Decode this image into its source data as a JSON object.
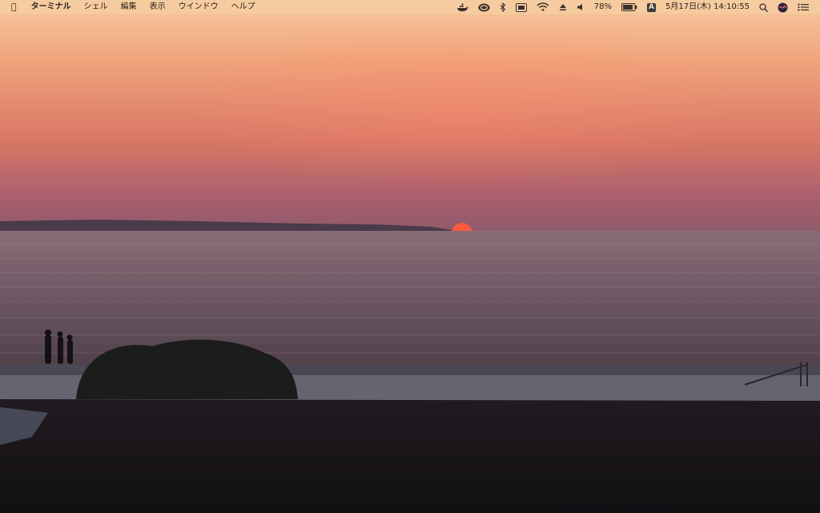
{
  "menubar": {
    "apple_icon": "apple-logo",
    "app_name": "ターミナル",
    "menus": [
      "シェル",
      "編集",
      "表示",
      "ウインドウ",
      "ヘルプ"
    ],
    "status": {
      "battery_percent": "78%",
      "ime_indicator": "A",
      "datetime": "5月17日(木) 14:10:55"
    }
  },
  "wallpaper": {
    "scene": "sunset-over-sea",
    "colors": {
      "sky_top": "#f0b88a",
      "sky_mid": "#e98e6a",
      "horizon": "#a8596a",
      "sun": "#ff5a40",
      "water": "#6f5660",
      "ground": "#161417"
    }
  }
}
